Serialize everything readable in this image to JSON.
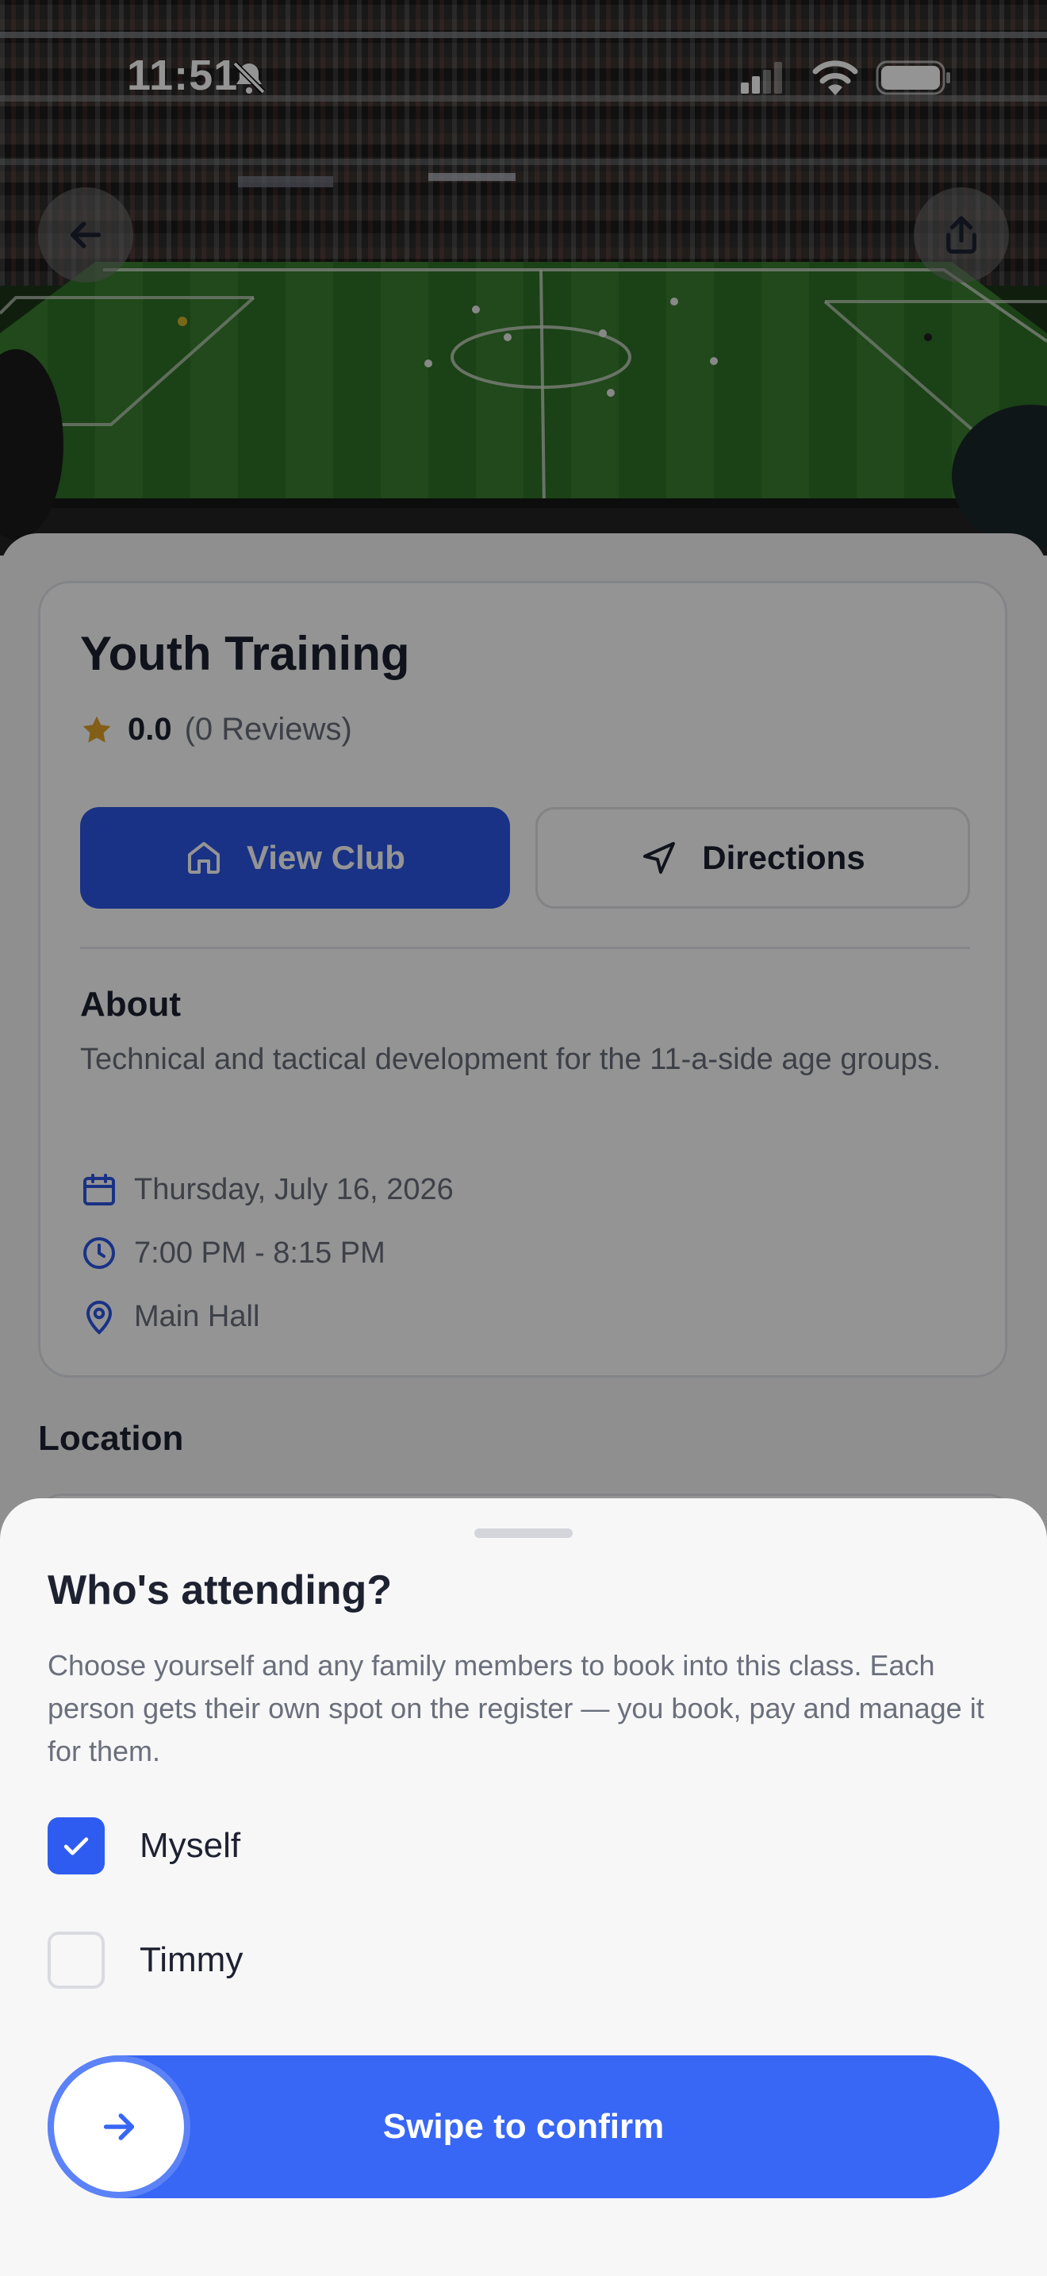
{
  "status_bar": {
    "time": "11:51"
  },
  "event": {
    "title": "Youth Training",
    "rating": "0.0",
    "reviews": "(0 Reviews)",
    "view_club_label": "View Club",
    "directions_label": "Directions",
    "about_heading": "About",
    "about_text": "Technical and tactical development for the 11-a-side age groups.",
    "date": "Thursday, July 16, 2026",
    "time": "7:00 PM - 8:15 PM",
    "venue": "Main Hall",
    "location_heading": "Location"
  },
  "sheet": {
    "title": "Who's attending?",
    "description": "Choose yourself and any family members to book into this class. Each person gets their own spot on the register — you book, pay and manage it for them.",
    "options": [
      {
        "label": "Myself",
        "checked": true
      },
      {
        "label": "Timmy",
        "checked": false
      }
    ],
    "swipe_label": "Swipe to confirm"
  },
  "colors": {
    "accent": "#2b56e6",
    "swipe": "#3866f5",
    "star": "#e0a227",
    "text": "#1d2130",
    "muted": "#6a6f7b"
  }
}
